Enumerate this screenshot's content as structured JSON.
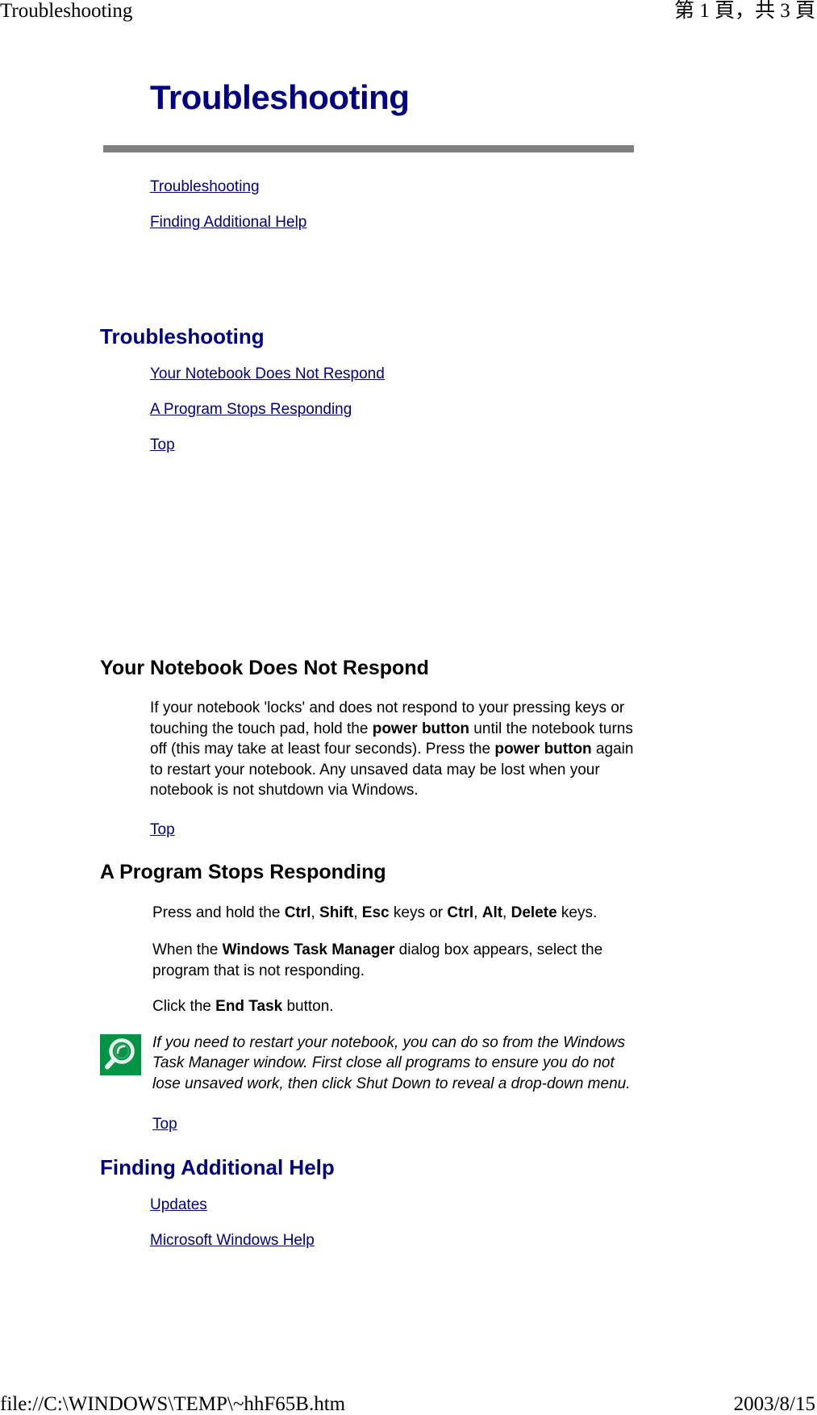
{
  "print": {
    "header_left": "Troubleshooting",
    "header_right": "第 1 頁，共 3 頁",
    "footer_left": "file://C:\\WINDOWS\\TEMP\\~hhF65B.htm",
    "footer_right": "2003/8/15"
  },
  "document": {
    "title": "Troubleshooting",
    "accent_color": "#000080",
    "rule_color": "#808080",
    "toc": [
      {
        "label": "Troubleshooting"
      },
      {
        "label": "Finding Additional Help"
      }
    ],
    "sections": [
      {
        "heading": "Troubleshooting",
        "links": [
          {
            "label": "Your Notebook Does Not Respond"
          },
          {
            "label": "A Program Stops Responding"
          },
          {
            "label": "Top"
          }
        ]
      },
      {
        "heading": "Your Notebook Does Not Respond",
        "body_parts": [
          {
            "text": "If your notebook 'locks' and does not respond to your pressing keys or touching the touch pad, hold the ",
            "bold": false
          },
          {
            "text": "power button",
            "bold": true
          },
          {
            "text": " until the notebook turns off (this may take at least four seconds). Press the ",
            "bold": false
          },
          {
            "text": "power button",
            "bold": true
          },
          {
            "text": " again to restart your notebook. Any unsaved data may be lost when your notebook is not shutdown via Windows.",
            "bold": false
          }
        ],
        "top_link": "Top"
      },
      {
        "heading": "A Program Stops Responding",
        "steps": [
          [
            {
              "text": "Press and hold the ",
              "bold": false
            },
            {
              "text": "Ctrl",
              "bold": true
            },
            {
              "text": ", ",
              "bold": false
            },
            {
              "text": "Shift",
              "bold": true
            },
            {
              "text": ", ",
              "bold": false
            },
            {
              "text": "Esc",
              "bold": true
            },
            {
              "text": " keys or ",
              "bold": false
            },
            {
              "text": "Ctrl",
              "bold": true
            },
            {
              "text": ", ",
              "bold": false
            },
            {
              "text": "Alt",
              "bold": true
            },
            {
              "text": ", ",
              "bold": false
            },
            {
              "text": "Delete",
              "bold": true
            },
            {
              "text": " keys.",
              "bold": false
            }
          ],
          [
            {
              "text": "When the ",
              "bold": false
            },
            {
              "text": "Windows Task Manager",
              "bold": true
            },
            {
              "text": " dialog box appears, select the program that is not responding.",
              "bold": false
            }
          ],
          [
            {
              "text": "Click the ",
              "bold": false
            },
            {
              "text": "End Task",
              "bold": true
            },
            {
              "text": " button.",
              "bold": false
            }
          ]
        ],
        "note": {
          "icon": "magnifier-note-icon",
          "icon_bg_color": "#009444",
          "text": "If you need to restart your notebook, you can do so from the Windows Task Manager window. First close all programs to ensure you do not lose unsaved work, then click Shut Down to reveal a drop-down menu."
        },
        "top_link": "Top"
      },
      {
        "heading": "Finding Additional Help",
        "links": [
          {
            "label": "Updates"
          },
          {
            "label": "Microsoft Windows Help"
          }
        ]
      }
    ]
  }
}
